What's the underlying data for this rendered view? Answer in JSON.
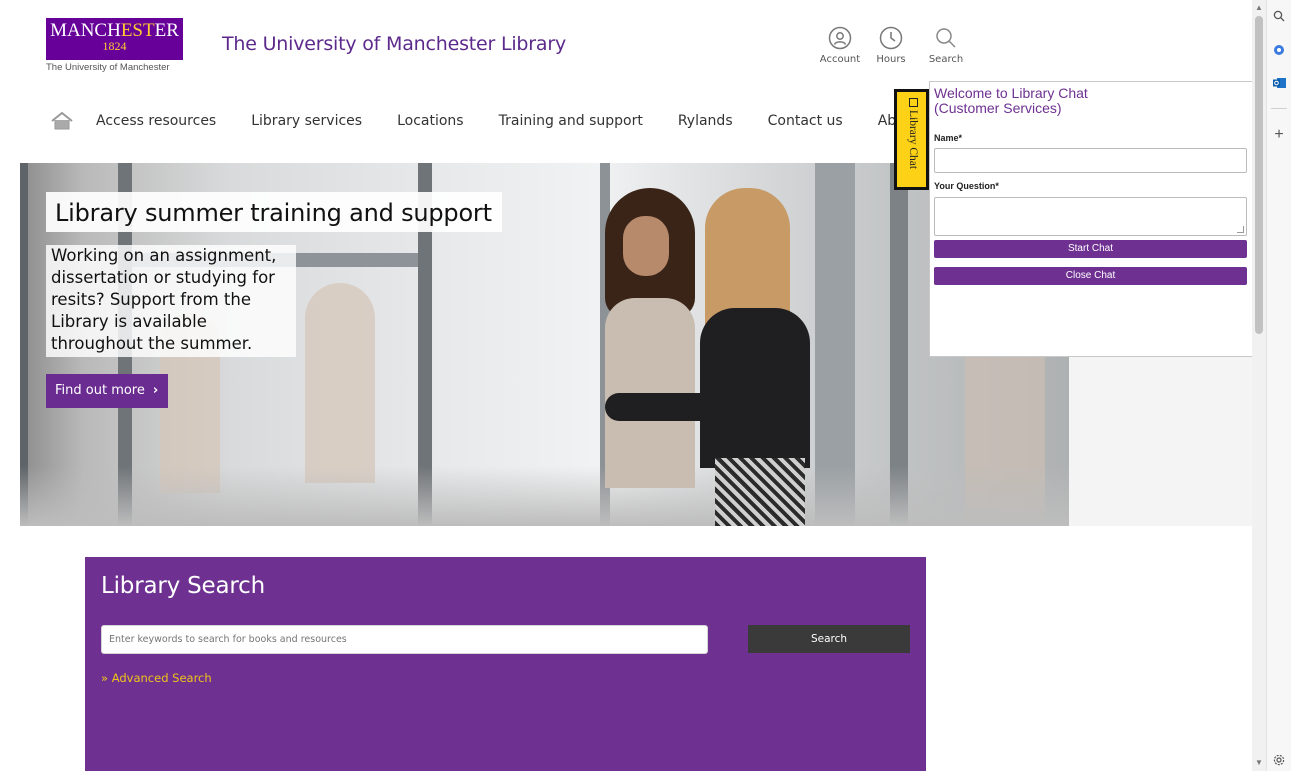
{
  "logo": {
    "word_before": "MANCH",
    "word_gold": "EST",
    "word_after": "ER",
    "year": "1824",
    "subtitle": "The University of Manchester"
  },
  "header": {
    "site_title": "The University of Manchester Library",
    "account_label": "Account",
    "hours_label": "Hours",
    "search_label": "Search"
  },
  "nav": {
    "items": [
      {
        "label": "Access resources"
      },
      {
        "label": "Library services"
      },
      {
        "label": "Locations"
      },
      {
        "label": "Training and support"
      },
      {
        "label": "Rylands"
      },
      {
        "label": "Contact us"
      },
      {
        "label": "About"
      }
    ]
  },
  "hero": {
    "title": "Library summer training and support",
    "text": "Working on an assignment, dissertation or studying for resits? Support from the Library is available throughout the summer.",
    "button_label": "Find out more",
    "button_chevron": "›"
  },
  "library_search": {
    "title": "Library Search",
    "placeholder": "Enter keywords to search for books and resources",
    "button_label": "Search",
    "advanced_link": "» Advanced Search"
  },
  "chat": {
    "tab_label": "Library Chat",
    "title_line1": "Welcome to Library Chat",
    "title_line2": "(Customer Services)",
    "name_label": "Name*",
    "question_label": "Your Question*",
    "start_button": "Start Chat",
    "close_button": "Close Chat"
  },
  "colors": {
    "brand_purple": "#660099",
    "accent_purple": "#6e3191",
    "gold": "#ffcc33",
    "chat_tab_yellow": "#fcd116"
  },
  "edge_rail": {
    "icons": [
      "search-icon",
      "copilot-icon",
      "outlook-icon",
      "plus-icon",
      "settings-icon"
    ]
  }
}
